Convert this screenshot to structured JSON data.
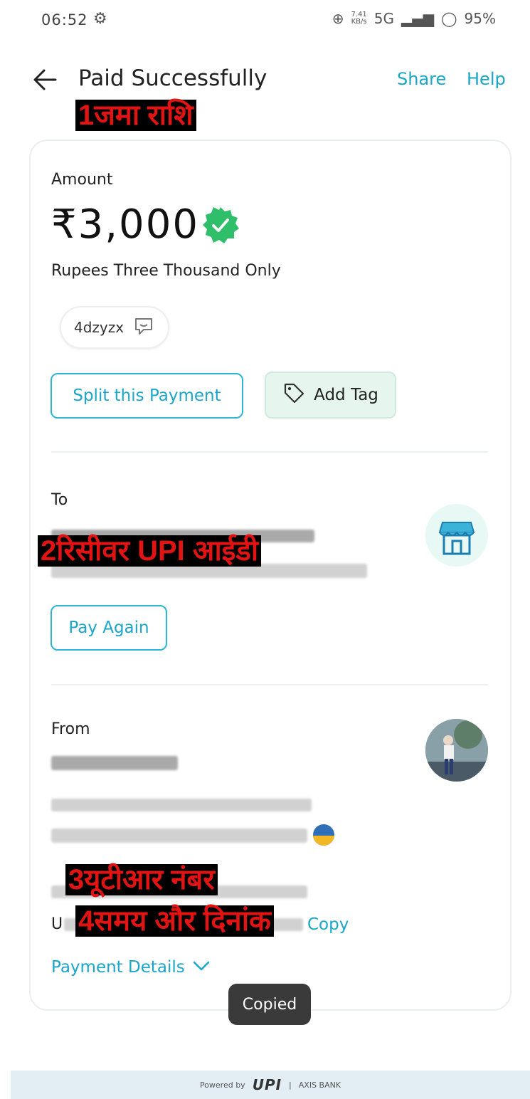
{
  "status_bar": {
    "time": "06:52",
    "network_rate": "7.41",
    "network_unit": "KB/s",
    "network_type": "5G",
    "battery": "95%",
    "icons": [
      "gear-icon",
      "wifi-calling-icon",
      "signal-icon",
      "battery-icon"
    ]
  },
  "header": {
    "title": "Paid Successfully",
    "share_label": "Share",
    "help_label": "Help",
    "accent_color": "#1aa6c9"
  },
  "annotations": {
    "label1": "1जमा राशि",
    "label2": "2रिसीवर UPI आईडी",
    "label3": "3यूटीआर नंबर",
    "label4": "4समय और दिनांक"
  },
  "amount_section": {
    "label": "Amount",
    "value": "₹3,000",
    "in_words": "Rupees Three Thousand Only",
    "note": "4dzyzx",
    "split_label": "Split this Payment",
    "add_tag_label": "Add Tag",
    "verified_color": "#2fbf6a"
  },
  "to_section": {
    "label": "To",
    "pay_again_label": "Pay Again"
  },
  "from_section": {
    "label": "From",
    "copy_label": "Copy",
    "upi_prefix": "U"
  },
  "payment_details_label": "Payment Details",
  "toast": "Copied",
  "footer": {
    "powered": "Powered by",
    "upi": "UPI",
    "bank": "AXIS BANK"
  }
}
